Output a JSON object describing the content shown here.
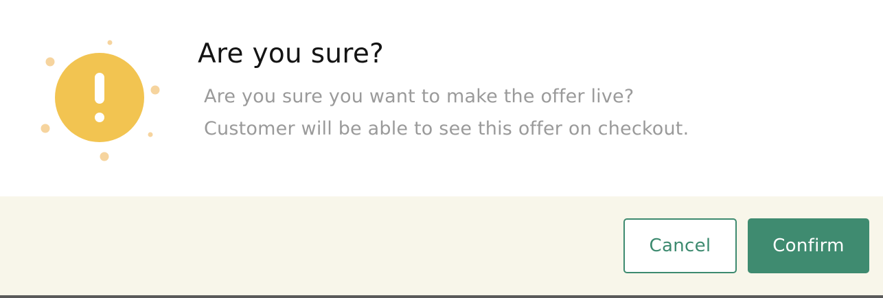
{
  "dialog": {
    "title": "Are you sure?",
    "message_line1": "Are you sure you want to make the offer live?",
    "message_line2": "Customer will be able to see this offer on checkout.",
    "icon": "exclamation-warning-icon",
    "colors": {
      "icon_circle": "#F2C451",
      "icon_dots": "#F6D49E",
      "footer_background": "#F8F6EA",
      "accent": "#3F8B70"
    }
  },
  "footer": {
    "cancel_label": "Cancel",
    "confirm_label": "Confirm"
  }
}
